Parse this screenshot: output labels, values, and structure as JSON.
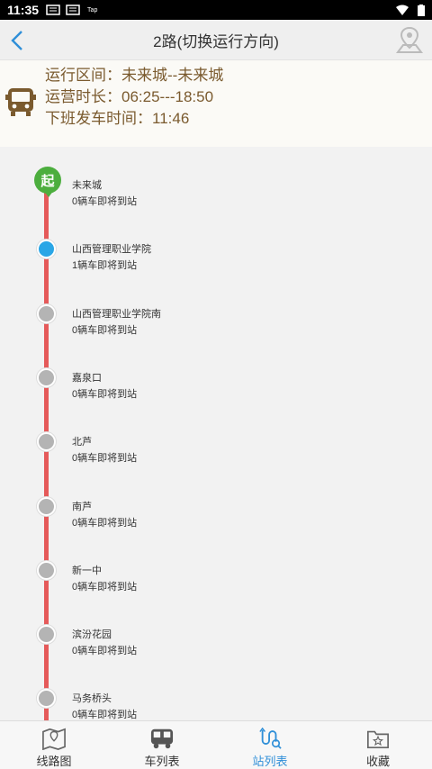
{
  "status_bar": {
    "time": "11:35",
    "notif_text": "Tap"
  },
  "header": {
    "title": "2路(切换运行方向)"
  },
  "route_info": {
    "range": "运行区间：未来城--未来城",
    "hours": "运营时长：06:25---18:50",
    "next_departure": "下班发车时间：11:46"
  },
  "start_badge": "起",
  "stations": [
    {
      "name": "未来城",
      "status": "0辆车即将到站",
      "active": false
    },
    {
      "name": "山西管理职业学院",
      "status": "1辆车即将到站",
      "active": true
    },
    {
      "name": "山西管理职业学院南",
      "status": "0辆车即将到站",
      "active": false
    },
    {
      "name": "嘉泉口",
      "status": "0辆车即将到站",
      "active": false
    },
    {
      "name": "北芦",
      "status": "0辆车即将到站",
      "active": false
    },
    {
      "name": "南芦",
      "status": "0辆车即将到站",
      "active": false
    },
    {
      "name": "新一中",
      "status": "0辆车即将到站",
      "active": false
    },
    {
      "name": "滨汾花园",
      "status": "0辆车即将到站",
      "active": false
    },
    {
      "name": "马务桥头",
      "status": "0辆车即将到站",
      "active": false
    }
  ],
  "tabs": [
    {
      "label": "线路图",
      "icon": "map-icon",
      "active": false
    },
    {
      "label": "车列表",
      "icon": "bus-icon",
      "active": false
    },
    {
      "label": "站列表",
      "icon": "station-list-icon",
      "active": true
    },
    {
      "label": "收藏",
      "icon": "favorite-folder-icon",
      "active": false
    }
  ],
  "colors": {
    "accent": "#2f8fd8",
    "route_line": "#e55a5a",
    "start": "#4cae3e",
    "info_text": "#7a5a2e"
  }
}
